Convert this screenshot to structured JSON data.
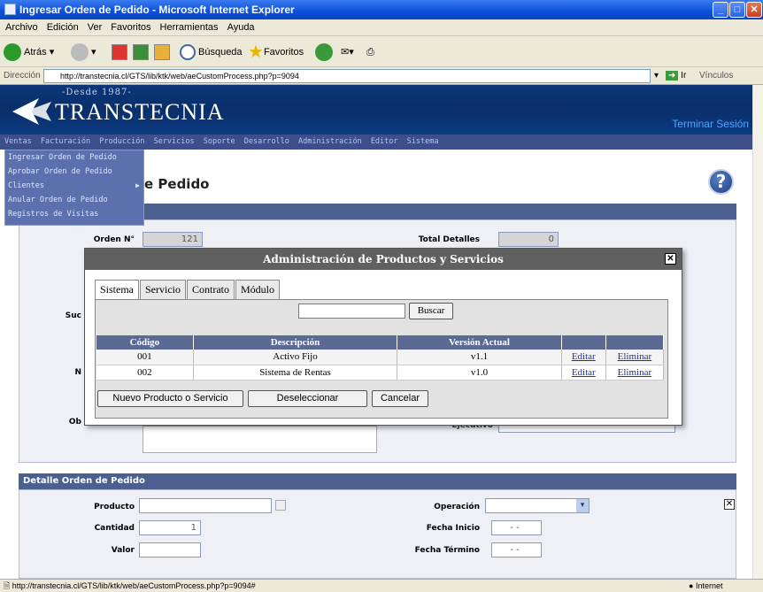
{
  "window": {
    "title": "Ingresar Orden de Pedido - Microsoft Internet Explorer"
  },
  "menubar": [
    "Archivo",
    "Edición",
    "Ver",
    "Favoritos",
    "Herramientas",
    "Ayuda"
  ],
  "toolbar": {
    "back": "Atrás",
    "search": "Búsqueda",
    "favorites": "Favoritos"
  },
  "address": {
    "label": "Dirección",
    "url": "http://transtecnia.cl/GTS/lib/ktk/web/aeCustomProcess.php?p=9094",
    "go": "Ir",
    "links": "Vínculos"
  },
  "header": {
    "since": "-Desde 1987-",
    "brand": "TRANSTECNIA",
    "logout": "Terminar Sesión"
  },
  "nav": [
    "Ventas",
    "Facturación",
    "Producción",
    "Servicios",
    "Soporte",
    "Desarrollo",
    "Administración",
    "Editor",
    "Sistema"
  ],
  "dropdown": [
    "Ingresar Orden de Pedido",
    "Aprobar Orden de Pedido",
    "Clientes",
    "Anular Orden de Pedido",
    "Registros de Visitas"
  ],
  "page": {
    "title_fragment": "e Pedido"
  },
  "order": {
    "order_no_label": "Orden N°",
    "order_no": "121",
    "total_label": "Total Detalles",
    "total": "0",
    "suc_label": "Suc",
    "n_label": "N",
    "ob_label": "Ob",
    "ejecutivo_label": "Ejecutivo"
  },
  "detail": {
    "header": "Detalle Orden de Pedido",
    "producto_label": "Producto",
    "producto": "",
    "cantidad_label": "Cantidad",
    "cantidad": "1",
    "valor_label": "Valor",
    "valor": "",
    "operacion_label": "Operación",
    "fecha_inicio_label": "Fecha Inicio",
    "fecha_inicio": "-  -",
    "fecha_termino_label": "Fecha Término",
    "fecha_termino": "-  -"
  },
  "modal": {
    "title": "Administración de Productos y Servicios",
    "tabs": [
      "Sistema",
      "Servicio",
      "Contrato",
      "Módulo"
    ],
    "search_button": "Buscar",
    "columns": [
      "Código",
      "Descripción",
      "Versión Actual"
    ],
    "rows": [
      {
        "code": "001",
        "desc": "Activo Fijo",
        "version": "v1.1",
        "edit": "Editar",
        "delete": "Eliminar"
      },
      {
        "code": "002",
        "desc": "Sistema de Rentas",
        "version": "v1.0",
        "edit": "Editar",
        "delete": "Eliminar"
      }
    ],
    "buttons": {
      "new": "Nuevo Producto o Servicio",
      "deselect": "Deseleccionar",
      "cancel": "Cancelar"
    }
  },
  "status": {
    "url": "http://transtecnia.cl/GTS/lib/ktk/web/aeCustomProcess.php?p=9094#",
    "zone": "Internet"
  }
}
